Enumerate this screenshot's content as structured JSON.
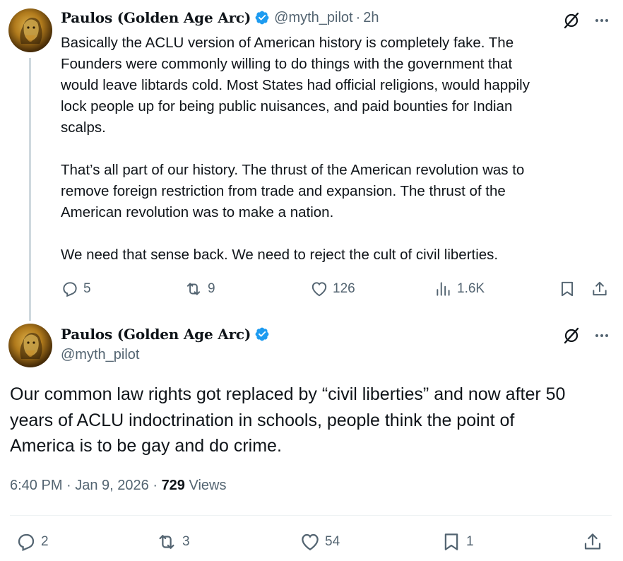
{
  "tweet1": {
    "author_name": "Paulos (Golden Age Arc)",
    "handle": "@myth_pilot",
    "separator": "·",
    "time": "2h",
    "paragraphs": [
      "Basically the ACLU version of American history is completely fake. The\nFounders were commonly willing to do things with the government that\nwould leave libtards cold. Most States had official religions, would happily\nlock people up for being public nuisances, and paid bounties for Indian\nscalps.",
      "That’s all part of our history. The thrust of the American revolution was to\nremove foreign restriction from trade and expansion. The thrust of the\nAmerican revolution was to make a nation.",
      "We need that sense back. We need to reject the cult of civil liberties."
    ],
    "replies": "5",
    "retweets": "9",
    "likes": "126",
    "views": "1.6K"
  },
  "tweet2": {
    "author_name": "Paulos (Golden Age Arc)",
    "handle": "@myth_pilot",
    "text": "Our common law rights got replaced by “civil liberties” and now after 50\nyears of ACLU indoctrination in schools, people think the point of\nAmerica is to be gay and do crime.",
    "timestamp": "6:40 PM · Jan 9, 2026 · ",
    "view_count": "729",
    "views_label": " Views",
    "replies": "2",
    "retweets": "3",
    "likes": "54",
    "bookmarks": "1"
  },
  "colors": {
    "text": "#0f1419",
    "secondary": "#536471",
    "verified": "#1d9bf0",
    "thread_line": "#cfd9de"
  },
  "icons": [
    "grok-icon",
    "more-icon",
    "reply-icon",
    "retweet-icon",
    "like-icon",
    "views-icon",
    "bookmark-icon",
    "share-icon",
    "verified-badge-icon"
  ]
}
